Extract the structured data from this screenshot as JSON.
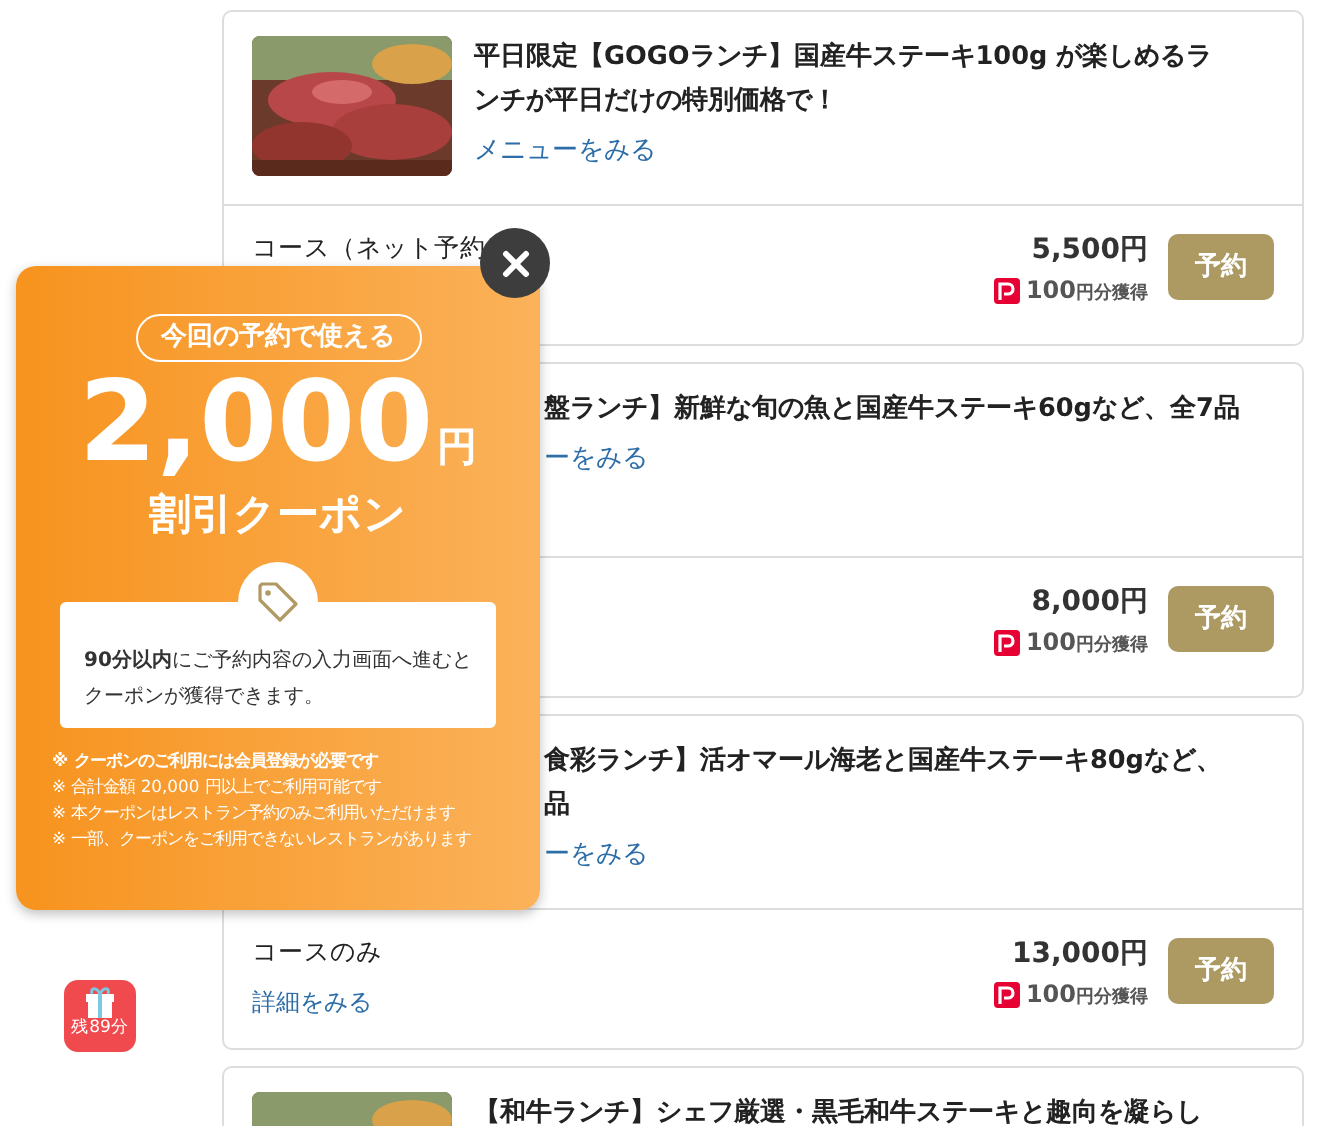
{
  "cards": [
    {
      "picture": true,
      "title_lines": [
        "平日限定【GOGOランチ】国産牛ステーキ100g が楽しめるラ",
        "ンチが平日だけの特別価格で！"
      ],
      "menu_link": "メニューをみる",
      "course": "コース（ネット予約",
      "price": "5,500円",
      "points": "100",
      "points_unit": "円分獲得",
      "button": "予約"
    },
    {
      "picture": false,
      "title_lines": [
        "盤ランチ】新鮮な旬の魚と国産牛ステーキ60gなど、全7品"
      ],
      "menu_link": "ーをみる",
      "price": "8,000円",
      "points": "100",
      "points_unit": "円分獲得",
      "button": "予約"
    },
    {
      "picture": false,
      "title_lines": [
        "食彩ランチ】活オマール海老と国産牛ステーキ80gなど、",
        "品"
      ],
      "menu_link": "ーをみる",
      "course": "コースのみ",
      "detail_link": "詳細をみる",
      "price": "13,000円",
      "points": "100",
      "points_unit": "円分獲得",
      "button": "予約"
    },
    {
      "picture": true,
      "title_lines": [
        "【和牛ランチ】シェフ厳選・黒毛和牛ステーキと趣向を凝らし"
      ]
    }
  ],
  "coupon": {
    "pill": "今回の予約で使える",
    "amount": "2,000",
    "currency": "円",
    "label": "割引クーポン",
    "message": "**90分以内**にご予約内容の入力画面へ進むとクーポンが獲得できます。",
    "notes": [
      {
        "text": "※ クーポンのご利用には会員登録が必要です",
        "bold": true
      },
      {
        "text": "※ 合計金額 20,000 円以上でご利用可能です",
        "bold": false
      },
      {
        "text": "※ 本クーポンはレストラン予約のみご利用いただけます",
        "bold": false
      },
      {
        "text": "※ 一部、クーポンをご利用できないレストランがあります",
        "bold": false
      }
    ]
  },
  "timer_badge": {
    "label": "残89分"
  }
}
